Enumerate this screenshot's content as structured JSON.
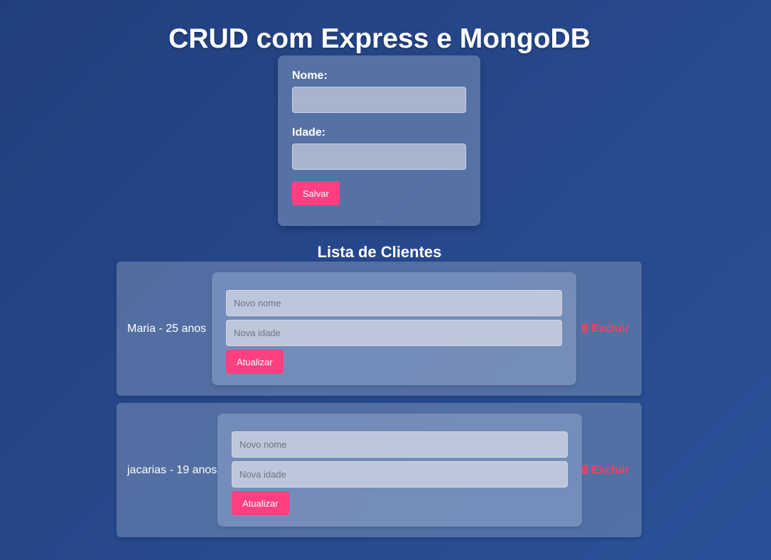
{
  "header": {
    "title": "CRUD com Express e MongoDB"
  },
  "form": {
    "name_label": "Nome:",
    "age_label": "Idade:",
    "name_value": "",
    "age_value": "",
    "save_label": "Salvar",
    "stray_char": "·"
  },
  "list": {
    "title": "Lista de Clientes",
    "clients": [
      {
        "text": "Maria - 25 anos",
        "name_placeholder": "Novo nome",
        "age_placeholder": "Nova idade",
        "update_label": "Atualizar",
        "delete_label": "Excluir"
      },
      {
        "text": "jacarias - 19 anos",
        "name_placeholder": "Novo nome",
        "age_placeholder": "Nova idade",
        "update_label": "Atualizar",
        "delete_label": "Excluir"
      }
    ]
  },
  "colors": {
    "accent": "#ff3f81",
    "delete": "#ff3b5c",
    "background": "#27488c"
  },
  "icons": {
    "delete": "trash-icon"
  }
}
